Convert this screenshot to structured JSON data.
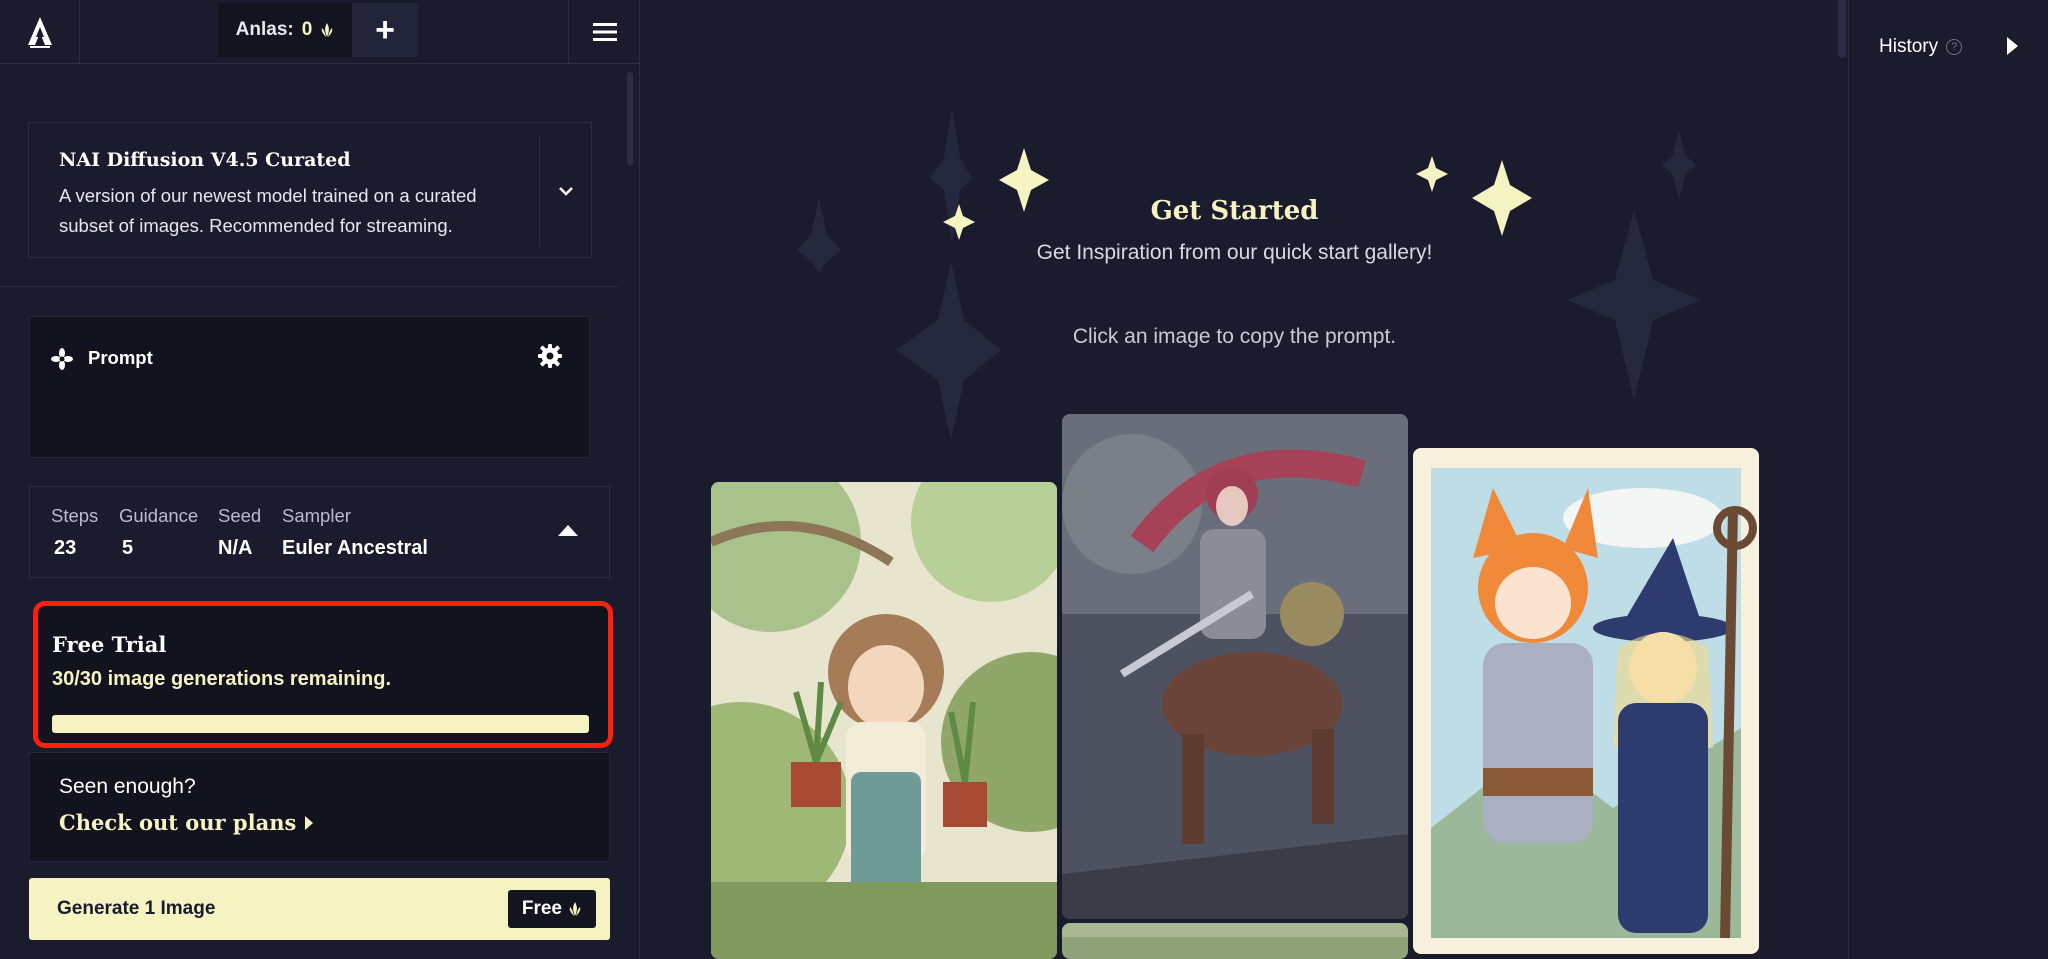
{
  "topbar": {
    "anlas_label": "Anlas:",
    "anlas_value": "0",
    "add_label": "+"
  },
  "model": {
    "name": "NAI Diffusion V4.5 Curated",
    "description": "A version of our newest model trained on a curated subset of images. Recommended for streaming."
  },
  "prompt": {
    "label": "Prompt"
  },
  "params": {
    "steps_label": "Steps",
    "steps_value": "23",
    "guidance_label": "Guidance",
    "guidance_value": "5",
    "seed_label": "Seed",
    "seed_value": "N/A",
    "sampler_label": "Sampler",
    "sampler_value": "Euler Ancestral"
  },
  "trial": {
    "title": "Free Trial",
    "remaining": "30/30 image generations remaining.",
    "progress_fraction": 1.0
  },
  "plans": {
    "question": "Seen enough?",
    "link": "Check out our plans"
  },
  "generate": {
    "label": "Generate 1 Image",
    "cost": "Free"
  },
  "main": {
    "title": "Get Started",
    "subtitle": "Get Inspiration from our quick start gallery!",
    "hint": "Click an image to copy the prompt."
  },
  "history": {
    "label": "History"
  },
  "colors": {
    "background": "#1a1c2e",
    "accent": "#f5f3c2",
    "highlight_border": "#ff1f0f"
  }
}
